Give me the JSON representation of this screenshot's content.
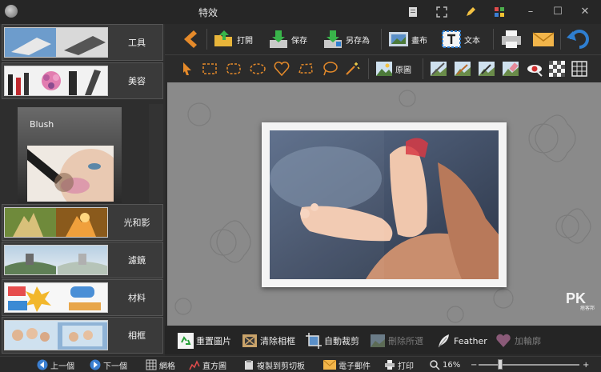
{
  "window": {
    "title": "特效"
  },
  "sidebar": {
    "categories": [
      {
        "label": "工具",
        "thumb_icon": "tools-thumbnail"
      },
      {
        "label": "美容",
        "thumb_icon": "makeup-thumbnail"
      },
      {
        "label": "光和影",
        "thumb_icon": "light-shadow-thumbnail"
      },
      {
        "label": "濾鏡",
        "thumb_icon": "filter-thumbnail"
      },
      {
        "label": "材料",
        "thumb_icon": "materials-thumbnail"
      },
      {
        "label": "相框",
        "thumb_icon": "frames-thumbnail"
      }
    ],
    "selected_effect": {
      "label": "Blush"
    }
  },
  "toolbar": {
    "open_label": "打開",
    "save_label": "保存",
    "save_as_label": "另存為",
    "canvas_label": "畫布",
    "text_label": "文本",
    "crop_label": "原圖"
  },
  "actions": {
    "reset_label": "重置圖片",
    "remove_frame_label": "清除相框",
    "auto_crop_label": "自動裁剪",
    "delete_selected_label": "刪除所選",
    "feather_label": "Feather",
    "outline_label": "加輪廓"
  },
  "status": {
    "prev_label": "上一個",
    "next_label": "下一個",
    "grid_label": "網格",
    "histogram_label": "直方圖",
    "copy_label": "複製到剪切板",
    "email_label": "電子郵件",
    "print_label": "打印",
    "zoom": "16%"
  },
  "watermark": {
    "text": "PK",
    "sub": "痞客邦"
  },
  "colors": {
    "background": "#2b2b2b",
    "canvas": "#8a8a8a",
    "accent_orange": "#e58a2a",
    "accent_blue": "#2f7fd1"
  }
}
